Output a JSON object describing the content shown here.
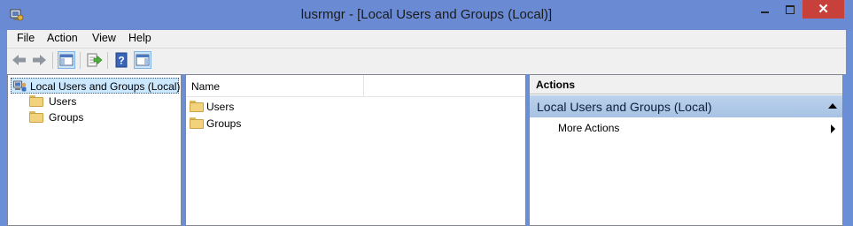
{
  "window": {
    "title": "lusrmgr - [Local Users and Groups (Local)]",
    "close_symbol": "✕"
  },
  "menu": [
    "File",
    "Action",
    "View",
    "Help"
  ],
  "toolbar": {
    "buttons": [
      "back-arrow-icon",
      "forward-arrow-icon",
      "show-hide-console-tree-icon",
      "export-list-icon",
      "help-icon",
      "show-hide-action-pane-icon"
    ]
  },
  "tree": {
    "root": "Local Users and Groups (Local)",
    "children": [
      "Users",
      "Groups"
    ]
  },
  "list": {
    "column_name": "Name",
    "rows": [
      "Users",
      "Groups"
    ]
  },
  "actions": {
    "header": "Actions",
    "section": "Local Users and Groups (Local)",
    "items": [
      "More Actions"
    ]
  },
  "colors": {
    "titlebar": "#6a8bd4",
    "close_button": "#c7403a",
    "selection": "#cce8ff",
    "actions_section": "#bcd2ec"
  }
}
